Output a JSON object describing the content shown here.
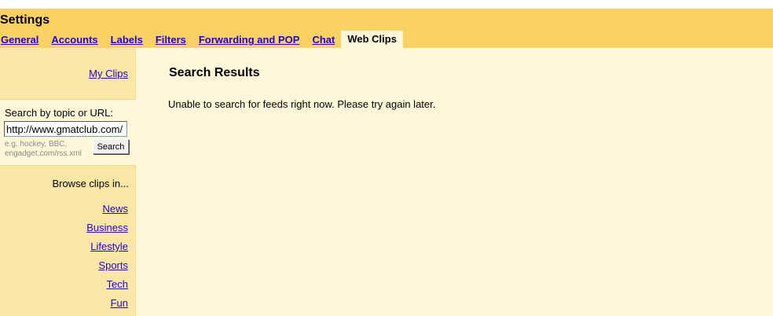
{
  "header": {
    "title": "Settings",
    "tabs": [
      {
        "label": "General"
      },
      {
        "label": "Accounts"
      },
      {
        "label": "Labels"
      },
      {
        "label": "Filters"
      },
      {
        "label": "Forwarding and POP"
      },
      {
        "label": "Chat"
      },
      {
        "label": "Web Clips",
        "active": true
      }
    ]
  },
  "sidebar": {
    "my_clips_label": "My Clips",
    "search": {
      "label": "Search by topic or URL:",
      "value": "http://www.gmatclub.com/",
      "hint": "e.g. hockey, BBC, engadget.com/rss.xml",
      "button_label": "Search"
    },
    "browse": {
      "title": "Browse clips in...",
      "categories": [
        "News",
        "Business",
        "Lifestyle",
        "Sports",
        "Tech",
        "Fun"
      ]
    }
  },
  "main": {
    "title": "Search Results",
    "message": "Unable to search for feeds right now. Please try again later."
  },
  "colors": {
    "header_bg": "#fad163",
    "content_bg": "#fff7d7",
    "sidebar_bg": "#fae6a5",
    "link": "#2200cc"
  }
}
